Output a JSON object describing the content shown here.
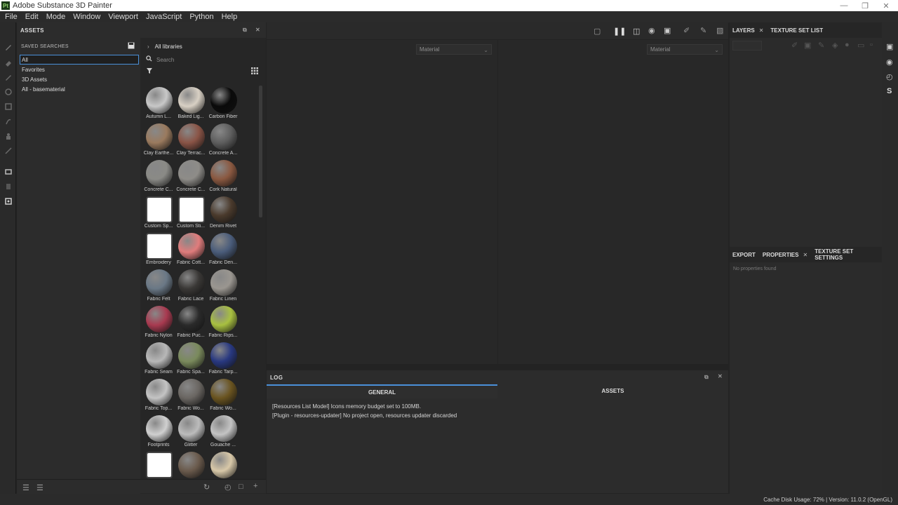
{
  "window": {
    "title": "Adobe Substance 3D Painter",
    "logo_text": "Pt"
  },
  "menu": [
    "File",
    "Edit",
    "Mode",
    "Window",
    "Viewport",
    "JavaScript",
    "Python",
    "Help"
  ],
  "assets_panel": {
    "title": "ASSETS",
    "saved_searches_label": "SAVED SEARCHES",
    "saved_items": [
      "All",
      "Favorites",
      "3D Assets",
      "All - basematerial"
    ],
    "libraries_label": "All libraries",
    "search_placeholder": "Search",
    "tiles": [
      {
        "label": "Autumn L...",
        "color": "#c8c8c8"
      },
      {
        "label": "Baked Lig...",
        "color": "#d8d0c4"
      },
      {
        "label": "Carbon Fiber",
        "color": "#0a0a0a"
      },
      {
        "label": "Clay Earthe...",
        "color": "#9a7a5e"
      },
      {
        "label": "Clay Terrac...",
        "color": "#8a5446"
      },
      {
        "label": "Concrete A...",
        "color": "#5e5e5e"
      },
      {
        "label": "Concrete C...",
        "color": "#8a8a86"
      },
      {
        "label": "Concrete C...",
        "color": "#8e8c88"
      },
      {
        "label": "Cork Natural",
        "color": "#8a5840"
      },
      {
        "label": "Custom Sp...",
        "color": "#ffffff"
      },
      {
        "label": "Custom Sti...",
        "color": "#ffffff"
      },
      {
        "label": "Denim Rivet",
        "color": "#4a3a2c"
      },
      {
        "label": "Embroidery",
        "color": "#ffffff"
      },
      {
        "label": "Fabric Cott...",
        "color": "#e07c7c"
      },
      {
        "label": "Fabric Den...",
        "color": "#4a5c7a"
      },
      {
        "label": "Fabric Felt",
        "color": "#6a7886"
      },
      {
        "label": "Fabric Lace",
        "color": "#3a3836"
      },
      {
        "label": "Fabric Linen",
        "color": "#9a9690"
      },
      {
        "label": "Fabric Nylon",
        "color": "#a83a50"
      },
      {
        "label": "Fabric Puc...",
        "color": "#2a2a2a"
      },
      {
        "label": "Fabric Rips...",
        "color": "#a8c040"
      },
      {
        "label": "Fabric Seam",
        "color": "#b8b8b8"
      },
      {
        "label": "Fabric Spa...",
        "color": "#7a8a5c"
      },
      {
        "label": "Fabric Tarp...",
        "color": "#283880"
      },
      {
        "label": "Fabric Top...",
        "color": "#c4c4c4"
      },
      {
        "label": "Fabric Wo...",
        "color": "#6a6662"
      },
      {
        "label": "Fabric Wo...",
        "color": "#6a5420"
      },
      {
        "label": "Footprints",
        "color": "#d0d0d0"
      },
      {
        "label": "Glitter",
        "color": "#bcbcbc"
      },
      {
        "label": "Gouache ...",
        "color": "#c4c4c4"
      },
      {
        "label": "",
        "color": "#ffffff"
      },
      {
        "label": "",
        "color": "#6a5a4c"
      },
      {
        "label": "",
        "color": "#d8c8a8"
      }
    ]
  },
  "viewport": {
    "left_select": "Material",
    "right_select": "Material"
  },
  "log": {
    "title": "LOG",
    "tabs": [
      "GENERAL",
      "ASSETS"
    ],
    "lines": [
      "[Resources List Model] Icons memory budget set to 100MB.",
      "[Plugin - resources-updater] No project open, resources updater discarded"
    ]
  },
  "right_panel": {
    "top_tabs": [
      "LAYERS",
      "TEXTURE SET LIST"
    ],
    "bottom_tabs": [
      "EXPORT",
      "PROPERTIES",
      "TEXTURE SET SETTINGS"
    ],
    "no_properties": "No properties found"
  },
  "status": {
    "text": "Cache Disk Usage:   72% | Version: 11.0.2 (OpenGL)"
  },
  "colors": {
    "accent": "#4a90d9",
    "bg": "#232323",
    "panel": "#2c2c2c"
  }
}
